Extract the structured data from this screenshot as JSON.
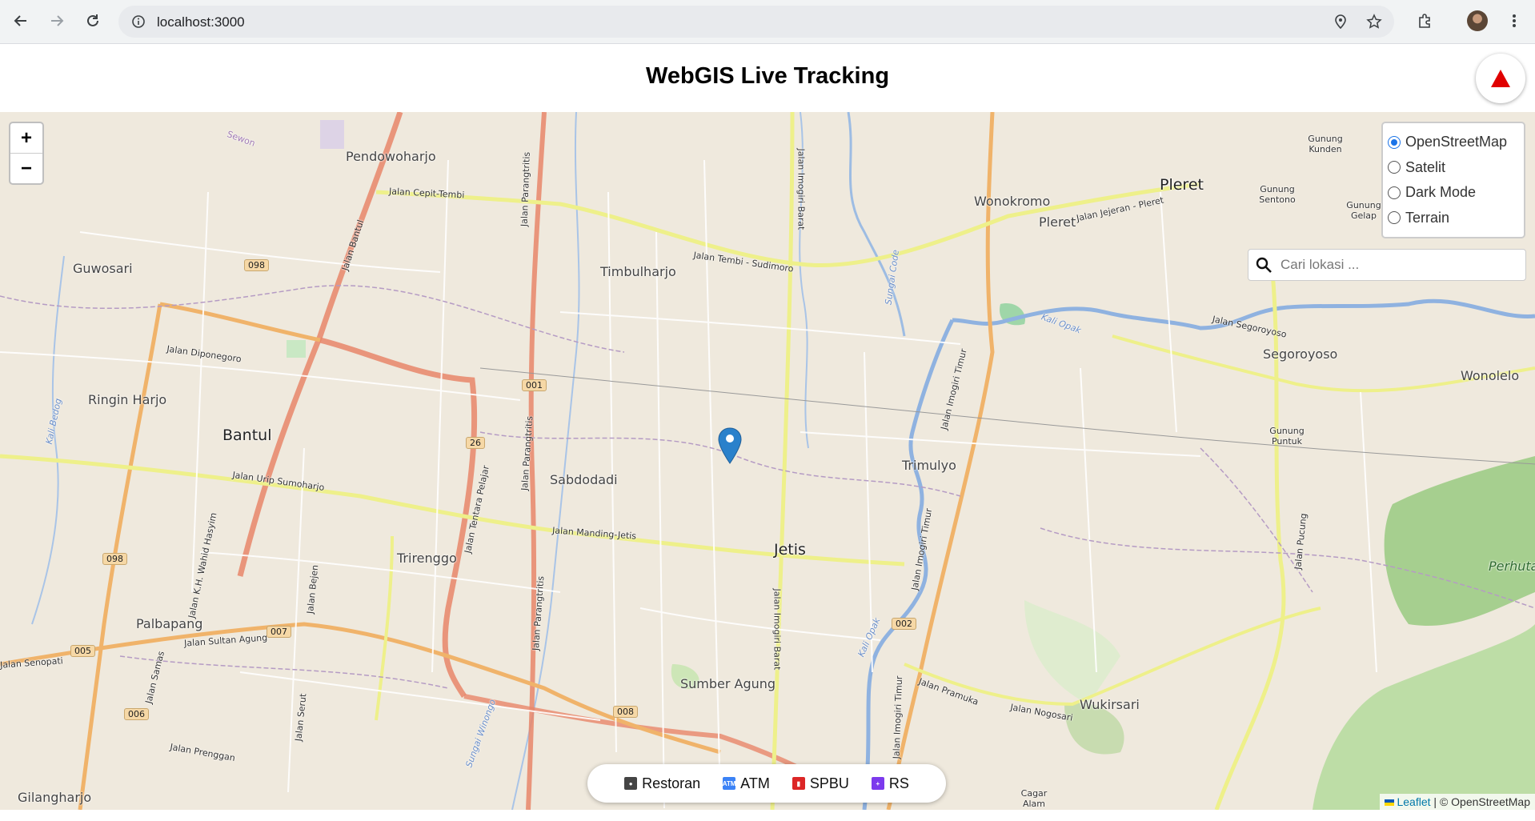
{
  "browser": {
    "url": "localhost:3000",
    "icons": [
      "back-icon",
      "forward-icon",
      "reload-icon",
      "site-info-icon",
      "location-icon",
      "star-icon",
      "extensions-icon",
      "avatar",
      "menu-icon"
    ]
  },
  "page": {
    "title": "WebGIS Live Tracking",
    "compass_icon": "north-arrow-icon"
  },
  "map": {
    "zoom_in": "+",
    "zoom_out": "−",
    "layers": [
      {
        "label": "OpenStreetMap",
        "selected": true
      },
      {
        "label": "Satelit",
        "selected": false
      },
      {
        "label": "Dark Mode",
        "selected": false
      },
      {
        "label": "Terrain",
        "selected": false
      }
    ],
    "search": {
      "placeholder": "Cari lokasi ..."
    },
    "poi": [
      {
        "label": "Restoran",
        "icon": "restaurant-icon",
        "color": "#333333"
      },
      {
        "label": "ATM",
        "icon": "atm-icon",
        "color": "#3b82f6"
      },
      {
        "label": "SPBU",
        "icon": "fuel-icon",
        "color": "#dc2626"
      },
      {
        "label": "RS",
        "icon": "hospital-icon",
        "color": "#7c3aed"
      }
    ],
    "attribution": {
      "leaflet": "Leaflet",
      "rest": "| © OpenStreetMap"
    },
    "places": {
      "pendowoharjo": "Pendowoharjo",
      "guwosari": "Guwosari",
      "timbulharjo": "Timbulharjo",
      "wonokromo": "Wonokromo",
      "pleret": "Pleret",
      "pleret_small": "Pleret",
      "gunung_kunden": "Gunung Kunden",
      "gunung_sentono": "Gunung Sentono",
      "gunung_gelap": "Gunung Gelap",
      "segoroyoso": "Segoroyoso",
      "wonolelo": "Wonolelo",
      "ringin_harjo": "Ringin Harjo",
      "bantul": "Bantul",
      "sabdodadi": "Sabdodadi",
      "trimulyo": "Trimulyo",
      "gunung_puntuk": "Gunung Puntuk",
      "jetis": "Jetis",
      "trirenggo": "Trirenggo",
      "palbapang": "Palbapang",
      "sumber_agung": "Sumber Agung",
      "wukirsari": "Wukirsari",
      "perhutani": "Perhutani",
      "gilangharjo": "Gilangharjo",
      "sewon": "Sewon",
      "cagar_alam": "Cagar Alam Imogiri"
    },
    "roads": {
      "cepit_tembi": "Jalan Cepit-Tembi",
      "tembi_sudimoro": "Jalan Tembi - Sudimoro",
      "jejeran_pleret": "Jalan Jejeran - Pleret",
      "segoroyoso": "Jalan Segoroyoso",
      "diponegoro": "Jalan Diponegoro",
      "urip_sumoharjo": "Jalan Urip Sumoharjo",
      "manding_jetis": "Jalan Manding-Jetis",
      "sultan_agung": "Jalan Sultan Agung",
      "pramuka": "Jalan Pramuka",
      "nogosari": "Jalan Nogosari",
      "prenggan": "Jalan Prenggan",
      "senopati": "Jalan Senopati",
      "bantul": "Jalan Bantul",
      "parangtritis": "Jalan Parangtritis",
      "imogiri_barat": "Jalan Imogiri Barat",
      "imogiri_timur": "Jalan Imogiri Timur",
      "kh_wahid": "Jalan K.H. Wahid Hasyim",
      "samas": "Jalan Samas",
      "bejen": "Jalan Bejen",
      "serut": "Jalan Serut",
      "pucung": "Jalan Pucung",
      "tentara_pelajar": "Jalan Tentara Pelajar",
      "sungai_code": "Sungai Code",
      "kali_opak": "Kali Opak",
      "sungai_winongo": "Sungai Winongo",
      "kali_bedog": "Kali Bedog"
    },
    "shields": [
      "098",
      "001",
      "26",
      "098",
      "007",
      "005",
      "006",
      "002",
      "008"
    ]
  }
}
